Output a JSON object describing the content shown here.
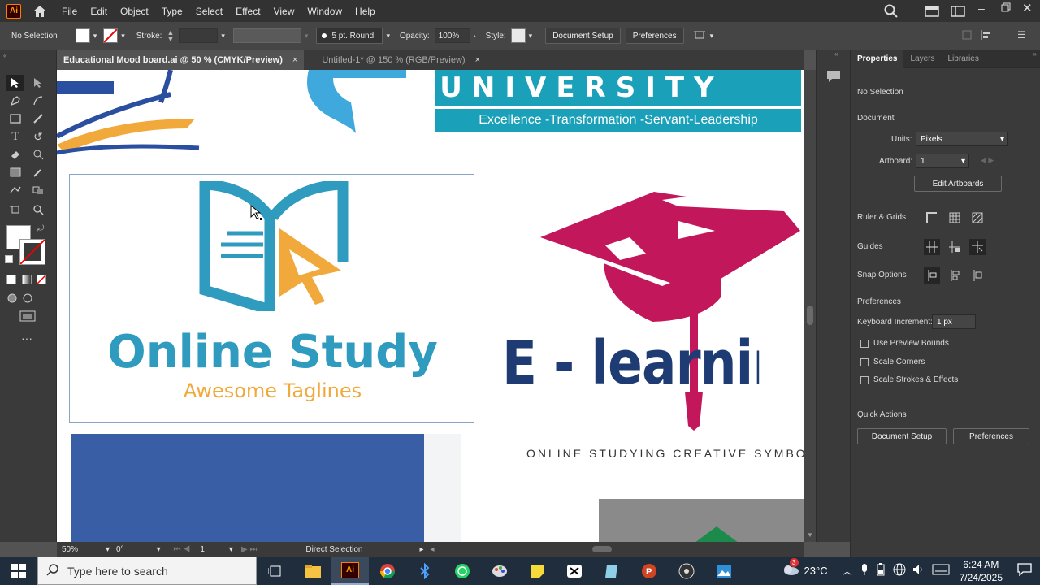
{
  "menubar": {
    "app_logo": "Ai",
    "items": [
      "File",
      "Edit",
      "Object",
      "Type",
      "Select",
      "Effect",
      "View",
      "Window",
      "Help"
    ]
  },
  "controlbar": {
    "selection": "No Selection",
    "stroke_label": "Stroke:",
    "brush": "5 pt. Round",
    "opacity_label": "Opacity:",
    "opacity_value": "100%",
    "style_label": "Style:",
    "document_setup": "Document Setup",
    "preferences": "Preferences"
  },
  "tabs": [
    {
      "label": "Educational Mood board.ai @ 50 % (CMYK/Preview)",
      "close": "×"
    },
    {
      "label": "Untitled-1* @ 150 % (RGB/Preview)",
      "close": "×"
    }
  ],
  "artwork": {
    "university_text": "UNIVERSITY",
    "university_tagline": "Excellence -Transformation -Servant-Leadership",
    "online_study_title": "Online Study",
    "online_study_tagline": "Awesome Taglines",
    "elearning_text": "E - learning",
    "elearning_tagline": "ONLINE STUDYING CREATIVE SYMBO"
  },
  "statusbar": {
    "zoom": "50%",
    "rotation": "0°",
    "artboard": "1",
    "tool": "Direct Selection"
  },
  "properties": {
    "tabs": [
      "Properties",
      "Layers",
      "Libraries"
    ],
    "no_selection": "No Selection",
    "document_label": "Document",
    "units_label": "Units:",
    "units_value": "Pixels",
    "artboard_label": "Artboard:",
    "artboard_value": "1",
    "edit_artboards": "Edit Artboards",
    "ruler_grids": "Ruler & Grids",
    "guides": "Guides",
    "snap_options": "Snap Options",
    "preferences_label": "Preferences",
    "keyboard_increment_label": "Keyboard Increment:",
    "keyboard_increment_value": "1 px",
    "use_preview_bounds": "Use Preview Bounds",
    "scale_corners": "Scale Corners",
    "scale_strokes": "Scale Strokes & Effects",
    "quick_actions": "Quick Actions",
    "document_setup_btn": "Document Setup",
    "preferences_btn": "Preferences"
  },
  "taskbar": {
    "search_placeholder": "Type here to search",
    "weather": "23°C",
    "weather_badge": "3",
    "time": "6:24 AM",
    "date": "7/24/2025"
  },
  "colors": {
    "accent_teal": "#2f9bbf",
    "accent_orange": "#f0a93a",
    "elearning_magenta": "#c2185b",
    "elearning_navy": "#1f3b73",
    "university_teal": "#1aa0b8",
    "blue_block": "#3a5ea6"
  }
}
